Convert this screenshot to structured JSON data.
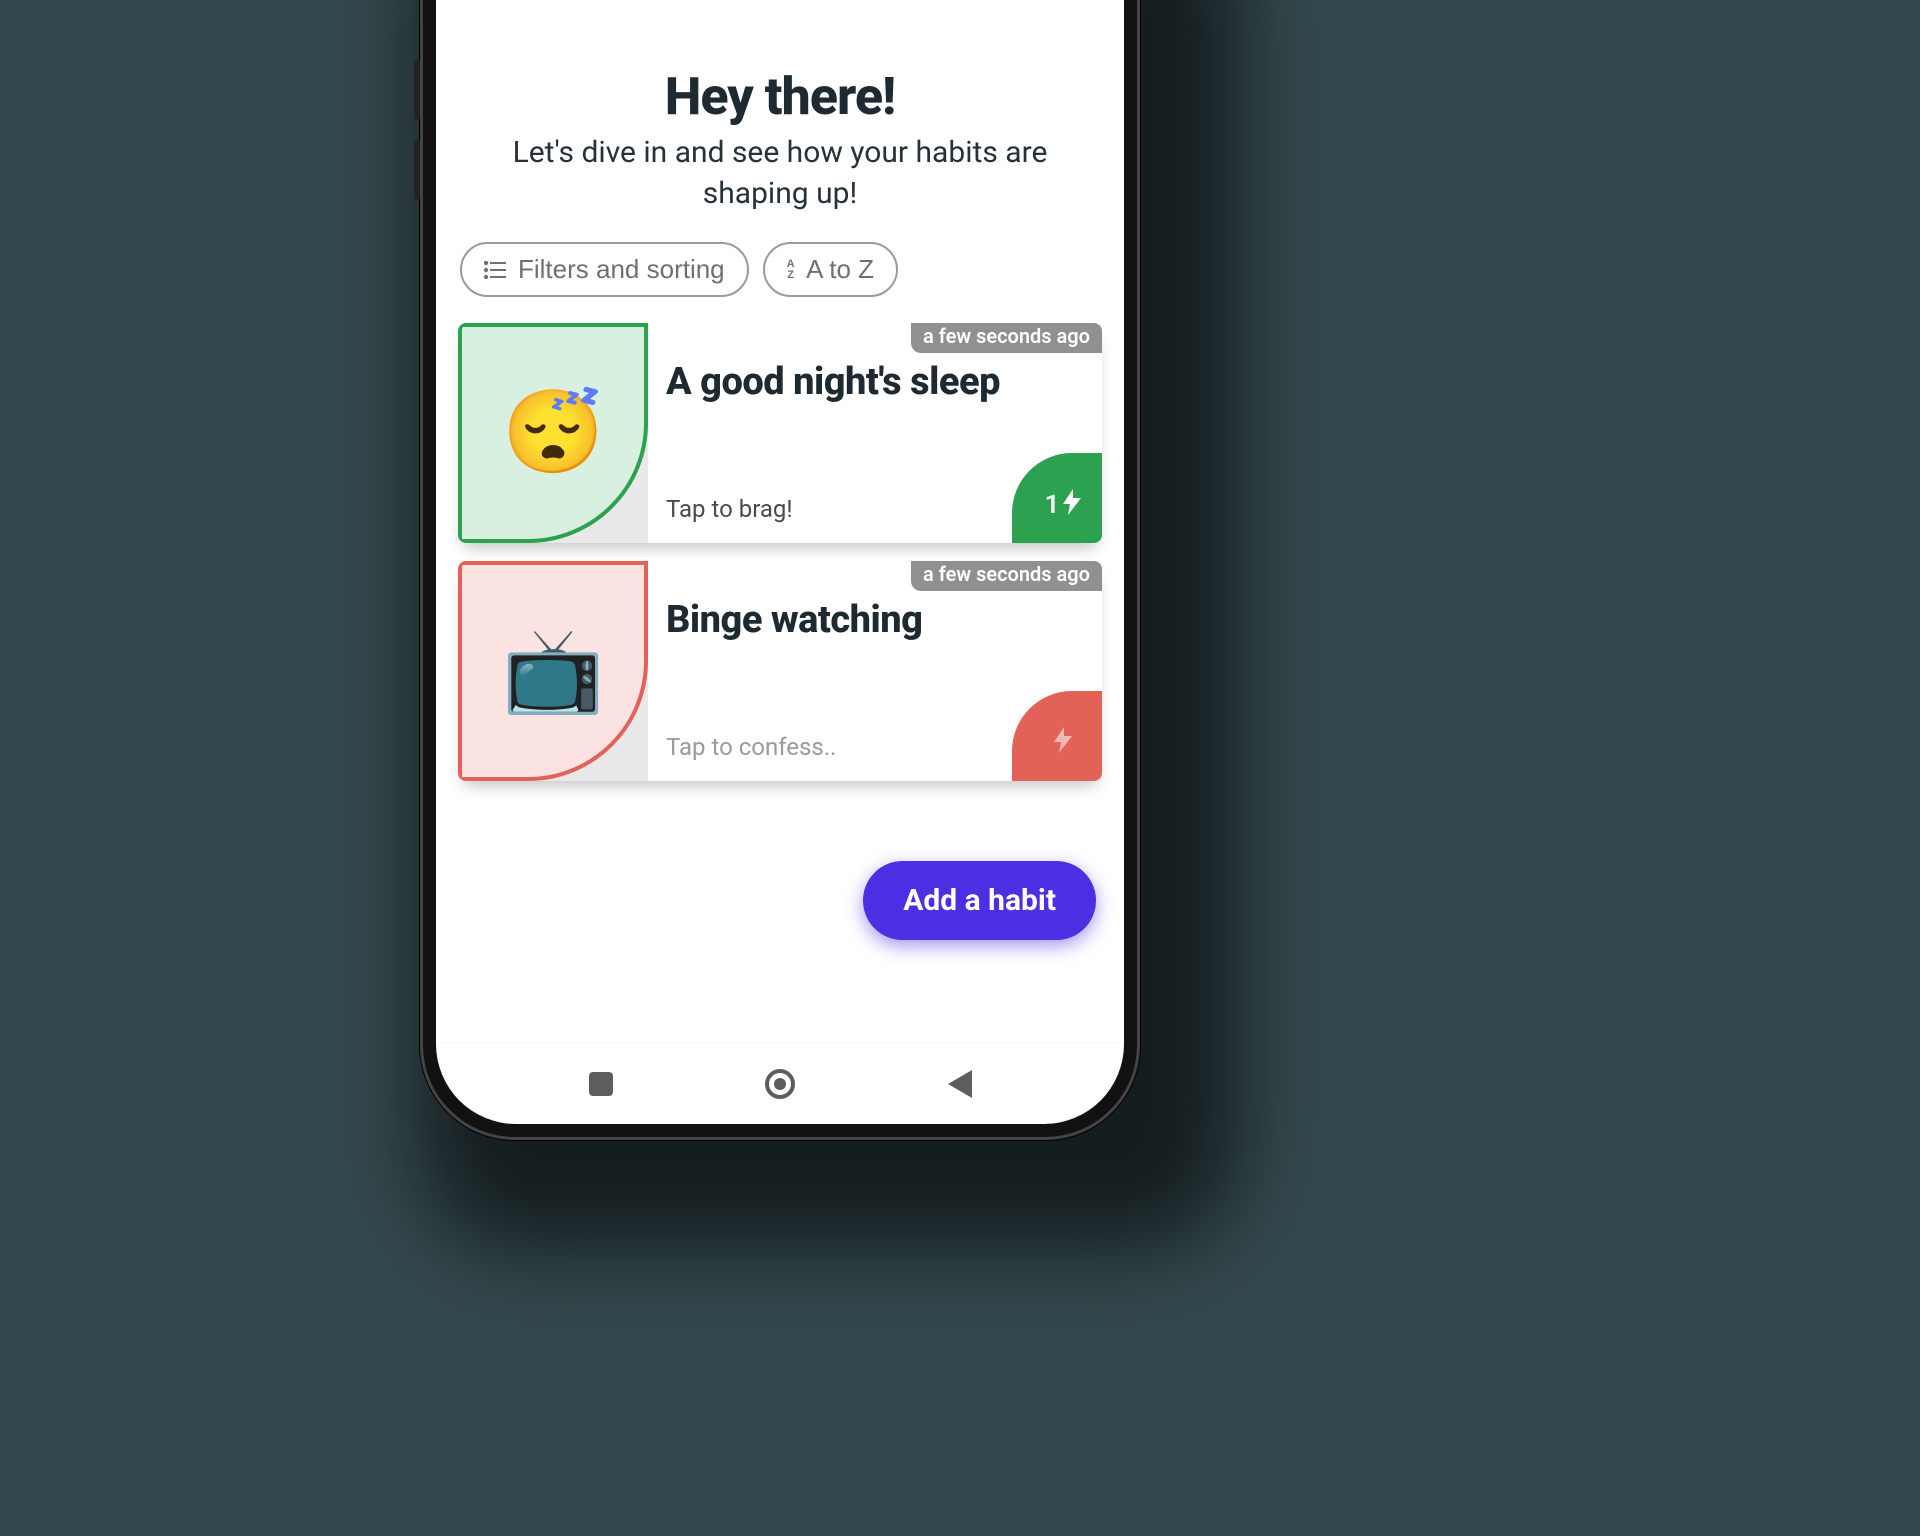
{
  "header": {
    "title": "Hey there!",
    "subtitle": "Let's dive in and see how your habits are shaping up!"
  },
  "chips": {
    "filters": "Filters and sorting",
    "sort": "A to Z"
  },
  "cards": [
    {
      "emoji": "😴",
      "title": "A good night's sleep",
      "subtitle": "Tap to brag!",
      "timestamp": "a few seconds ago",
      "streak": "1",
      "color": "green"
    },
    {
      "emoji": "📺",
      "title": "Binge watching",
      "subtitle": "Tap to confess..",
      "timestamp": "a few seconds ago",
      "streak": "",
      "color": "red"
    }
  ],
  "fab": {
    "label": "Add a habit"
  }
}
